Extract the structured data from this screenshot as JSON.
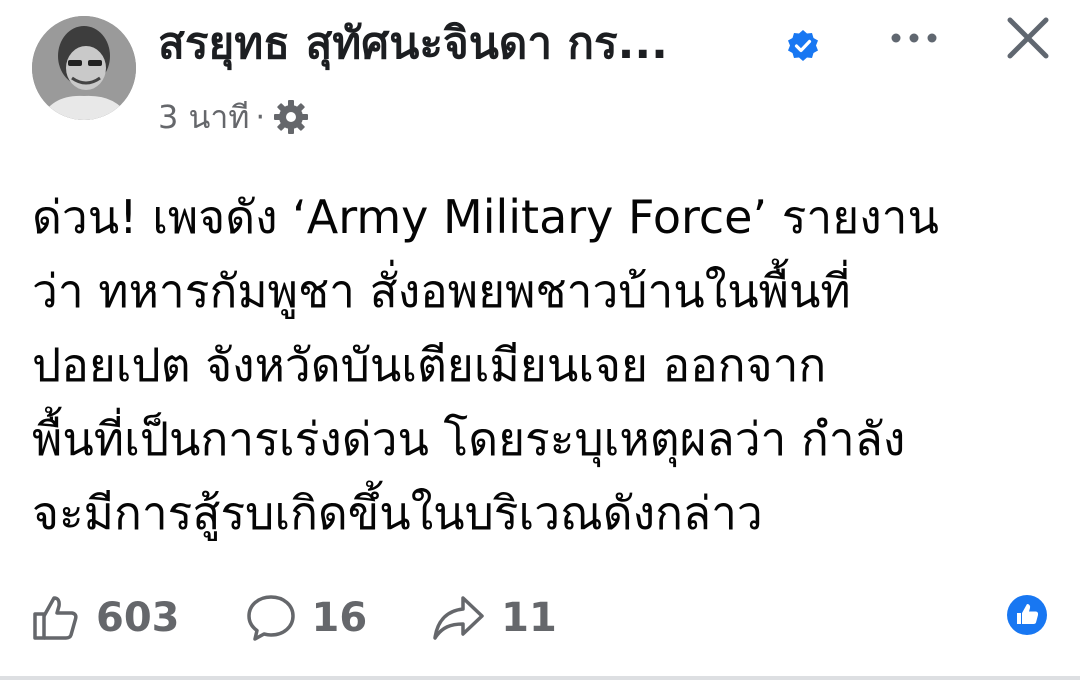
{
  "post": {
    "author": {
      "name": "สรยุทธ สุทัศนะจินดา กร...",
      "verified": true,
      "avatar_icon": "profile-photo"
    },
    "meta": {
      "time": "3 นาที",
      "separator": "·",
      "privacy_icon": "gear-icon"
    },
    "text_lines": [
      "ด่วน! เพจดัง ‘Army Military Force’ รายงาน",
      "ว่า ทหารกัมพูชา สั่งอพยพชาวบ้านในพื้นที่",
      "ปอยเปต จังหวัดบันเตียเมียนเจย ออกจาก",
      "พื้นที่เป็นการเร่งด่วน โดยระบุเหตุผลว่า กำลัง",
      "จะมีการสู้รบเกิดขึ้นในบริเวณดังกล่าว"
    ],
    "actions": {
      "likes": "603",
      "comments": "16",
      "shares": "11"
    }
  },
  "colors": {
    "accent_blue": "#1877f2",
    "secondary_text": "#65676b",
    "primary_text": "#050505"
  }
}
